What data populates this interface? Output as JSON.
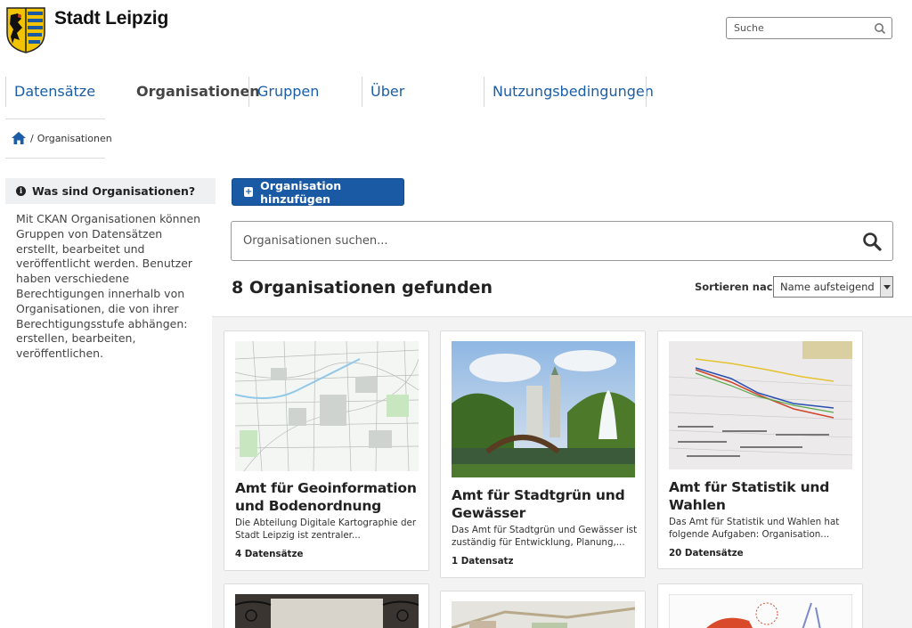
{
  "header": {
    "site_title": "Stadt Leipzig",
    "search_placeholder": "Suche"
  },
  "nav": {
    "items": [
      {
        "label": "Datensätze",
        "active": false
      },
      {
        "label": "Organisationen",
        "active": true
      },
      {
        "label": "Gruppen",
        "active": false
      },
      {
        "label": "Über",
        "active": false
      },
      {
        "label": "Nutzungsbedingungen",
        "active": false
      }
    ]
  },
  "breadcrumb": {
    "separator": "/",
    "current": "Organisationen"
  },
  "sidebar": {
    "heading": "Was sind Organisationen?",
    "text": "Mit CKAN Organisationen können Gruppen von Datensätzen erstellt, bearbeitet und veröffentlicht werden. Benutzer haben verschiedene Berechtigungen innerhalb von Organisationen, die von ihrer Berechtigungsstufe abhängen: erstellen, bearbeiten, veröffentlichen."
  },
  "main": {
    "add_button": "Organisation hinzufügen",
    "search_placeholder": "Organisationen suchen...",
    "result_count": "8 Organisationen gefunden",
    "sort_label": "Sortieren nach:",
    "sort_value": "Name aufsteigend"
  },
  "cards": [
    {
      "title": "Amt für Geoinformation und Bodenordnung",
      "description": "Die Abteilung Digitale Kartographie der Stadt Leipzig ist zentraler...",
      "count": "4 Datensätze",
      "image": "city-map"
    },
    {
      "title": "Amt für Stadtgrün und Gewässer",
      "description": "Das Amt für Stadtgrün und Gewässer ist zuständig für Entwicklung, Planung,...",
      "count": "1 Datensatz",
      "image": "park-fountain-photo"
    },
    {
      "title": "Amt für Statistik und Wahlen",
      "description": "Das Amt für Statistik und Wahlen hat folgende Aufgaben: Organisation...",
      "count": "20 Datensätze",
      "image": "statistics-chart-photo"
    },
    {
      "image": "hall-chandeliers-photo"
    },
    {
      "image": "aerial-plan"
    },
    {
      "image": "diagram-sketch"
    }
  ],
  "colors": {
    "primary": "#1a5aa5",
    "nav_link": "#1b5ea6",
    "sidebar_bg": "#eef0f2",
    "grid_bg": "#f3f3f3"
  }
}
